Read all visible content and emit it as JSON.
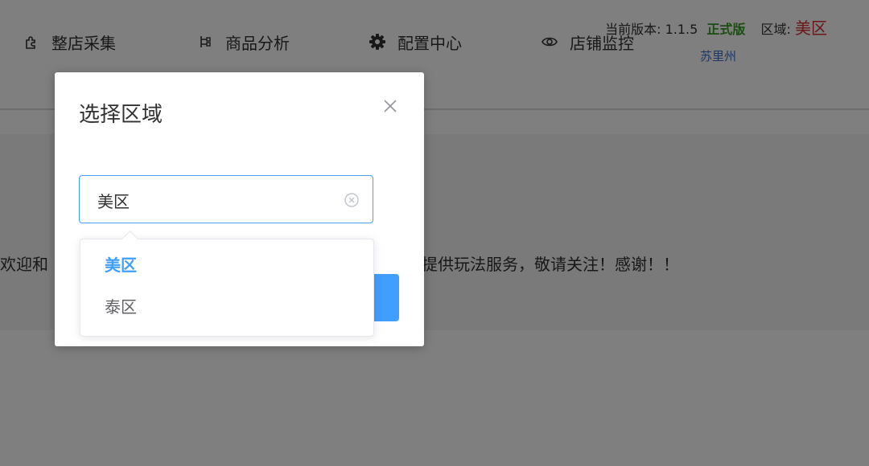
{
  "header": {
    "nav": [
      {
        "label": "整店采集",
        "icon": "puzzle-icon"
      },
      {
        "label": "商品分析",
        "icon": "branch-icon"
      },
      {
        "label": "配置中心",
        "icon": "gear-icon"
      },
      {
        "label": "店铺监控",
        "icon": "eye-icon"
      }
    ],
    "version_label": "当前版本:",
    "version_number": "1.1.5",
    "version_tag": "正式版",
    "region_label": "区域:",
    "region_value": "美区",
    "location": "苏里州"
  },
  "content": {
    "welcome_left": "欢迎和",
    "welcome_right": "提供玩法服务，敬请关注！感谢！！"
  },
  "dialog": {
    "title": "选择区域",
    "select_value": "美区",
    "options": [
      {
        "label": "美区",
        "selected": true
      },
      {
        "label": "泰区",
        "selected": false
      }
    ]
  },
  "colors": {
    "accent": "#409eff",
    "version_tag": "#3a9a2a",
    "region_value": "#d62f2f",
    "location": "#3d6fc4"
  }
}
